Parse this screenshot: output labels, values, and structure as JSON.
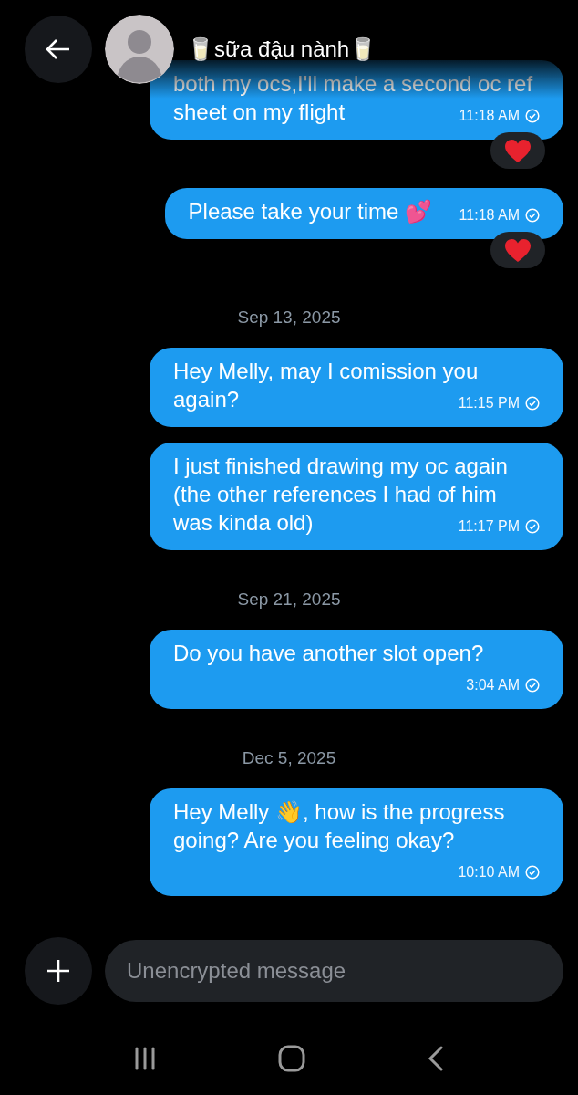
{
  "header": {
    "title": "🥛sữa đậu nành🥛"
  },
  "items": [
    {
      "kind": "message",
      "text": "both my ocs,I'll make a second oc ref sheet on my flight",
      "time": "11:18 AM",
      "reacted": true
    },
    {
      "kind": "message",
      "text": "Please take your time 💕",
      "time": "11:18 AM",
      "reacted": true
    },
    {
      "kind": "date",
      "text": "Sep 13, 2025"
    },
    {
      "kind": "message",
      "text": "Hey Melly, may I comission you again?",
      "time": "11:15 PM",
      "reacted": false
    },
    {
      "kind": "message",
      "text": "I just finished drawing my oc again (the other references I had of him was kinda old)",
      "time": "11:17 PM",
      "reacted": false
    },
    {
      "kind": "date",
      "text": "Sep 21, 2025"
    },
    {
      "kind": "message",
      "text": "Do you have another slot open?",
      "time": "3:04 AM",
      "reacted": false
    },
    {
      "kind": "date",
      "text": "Dec 5, 2025"
    },
    {
      "kind": "message",
      "text": "Hey Melly 👋,  how is the progress going? Are you feeling okay?",
      "time": "10:10 AM",
      "reacted": false
    }
  ],
  "composer": {
    "placeholder": "Unencrypted message"
  }
}
